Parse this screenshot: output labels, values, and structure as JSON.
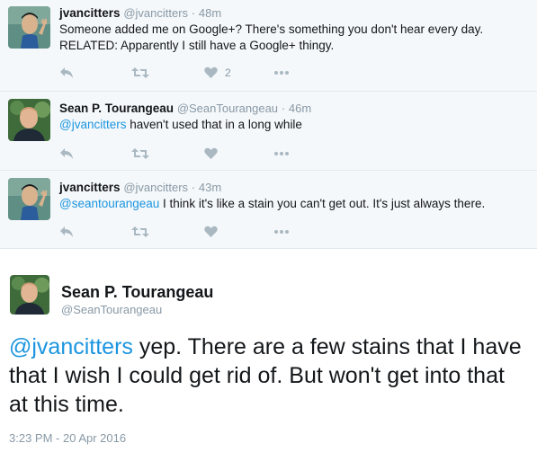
{
  "thread": [
    {
      "name": "jvancitters",
      "handle": "@jvancitters",
      "separator": "·",
      "time": "48m",
      "line1": "Someone added me on Google+? There's something you don't hear every day.",
      "line2": "RELATED: Apparently I still have a Google+ thingy.",
      "like_count": "2",
      "avatar": "spock-avatar"
    },
    {
      "name": "Sean P. Tourangeau",
      "handle": "@SeanTourangeau",
      "separator": "·",
      "time": "46m",
      "mention": "@jvancitters",
      "text": " haven't used that in a long while",
      "avatar": "sean-avatar"
    },
    {
      "name": "jvancitters",
      "handle": "@jvancitters",
      "separator": "·",
      "time": "43m",
      "mention": "@seantourangeau",
      "text": " I think it's like a stain you can't get out. It's just always there.",
      "avatar": "spock-avatar"
    }
  ],
  "focus": {
    "name": "Sean P. Tourangeau",
    "handle": "@SeanTourangeau",
    "mention": "@jvancitters",
    "text": " yep. There are a few stains that I have that I wish I could get rid of. But won't get into that at this time.",
    "timestamp": "3:23 PM - 20 Apr 2016"
  },
  "colors": {
    "link": "#1b95e0",
    "muted": "#8899a6",
    "icon": "#aab8c2",
    "thread_bg": "#f5f8fa"
  }
}
